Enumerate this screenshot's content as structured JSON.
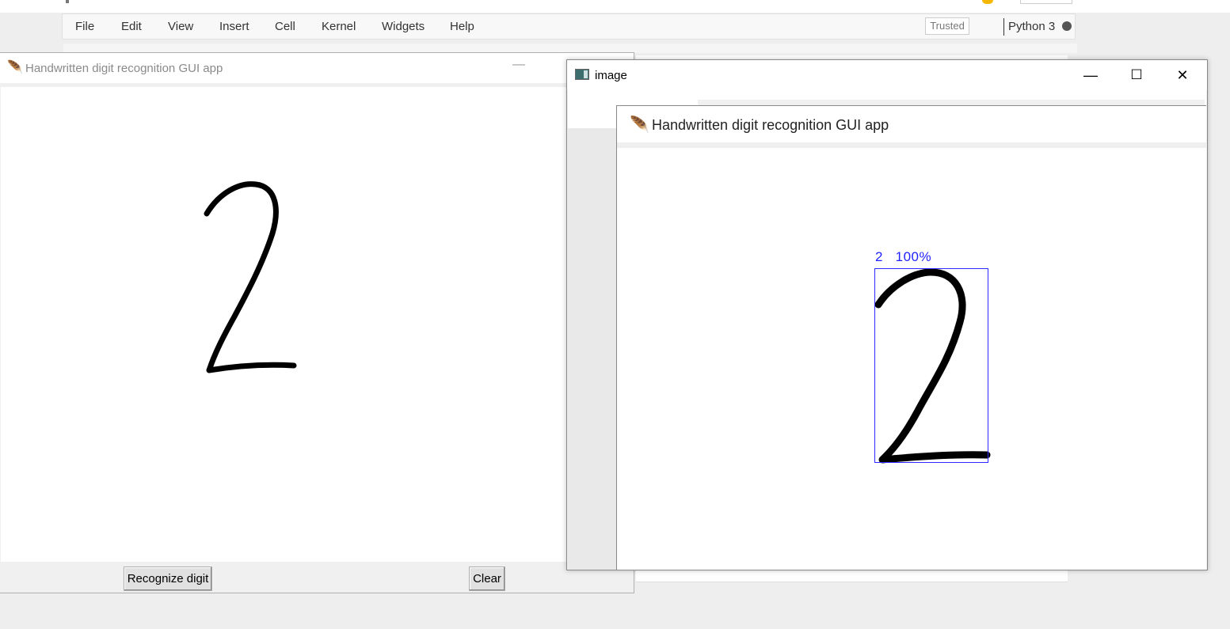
{
  "jupyter": {
    "menu": [
      "File",
      "Edit",
      "View",
      "Insert",
      "Cell",
      "Kernel",
      "Widgets",
      "Help"
    ],
    "trusted_label": "Trusted",
    "kernel_label": "Python 3"
  },
  "left_window": {
    "title": "Handwritten digit recognition GUI app",
    "recognize_button": "Recognize digit",
    "clear_button": "Clear"
  },
  "image_window": {
    "title": "image",
    "controls": {
      "minimize": "—",
      "maximize": "☐",
      "close": "✕"
    },
    "inner_title": "Handwritten digit recognition GUI app",
    "prediction": {
      "digit": "2",
      "confidence": "100%"
    }
  },
  "colors": {
    "bbox": "#2b2bff",
    "ink": "#000000"
  }
}
